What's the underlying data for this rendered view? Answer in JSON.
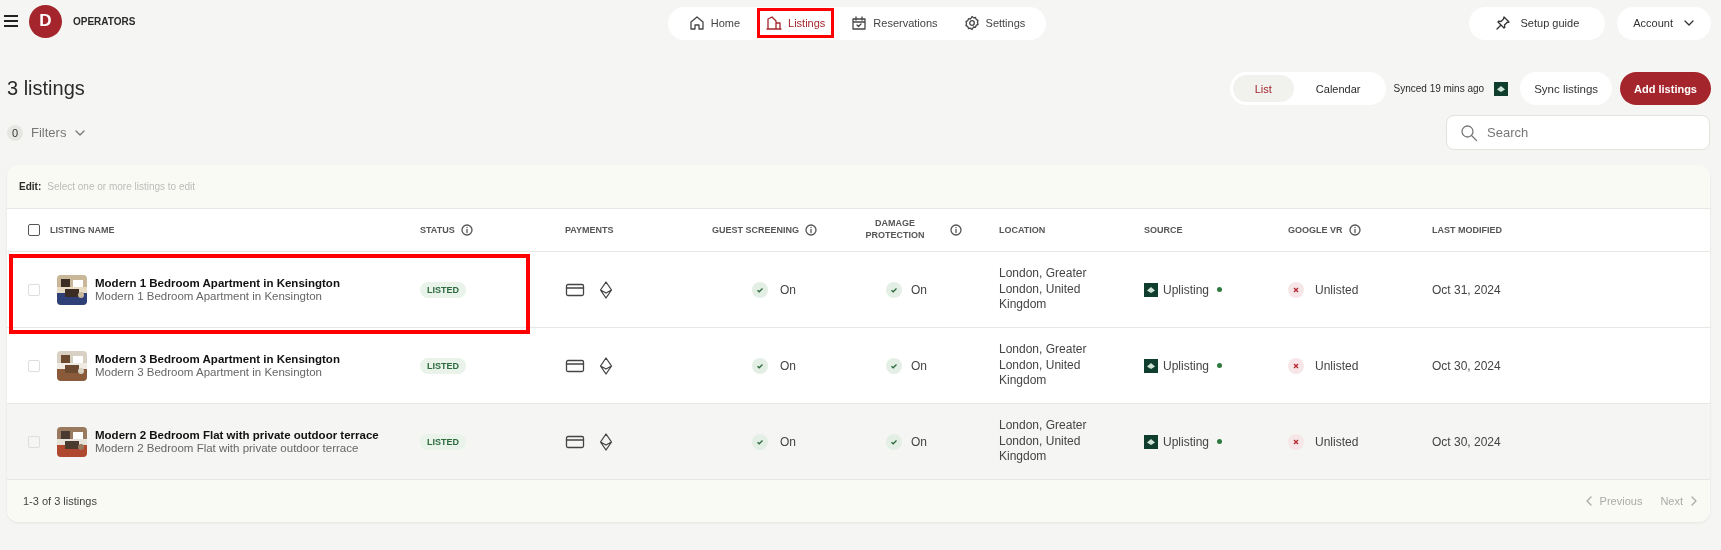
{
  "topbar": {
    "logo_letter": "D",
    "brand": "OPERATORS",
    "nav_items": [
      {
        "kind": "home",
        "label": "Home",
        "selected": false,
        "highlighted": false
      },
      {
        "kind": "listings",
        "label": "Listings",
        "selected": true,
        "highlighted": true
      },
      {
        "kind": "reservations",
        "label": "Reservations",
        "selected": false,
        "highlighted": false
      },
      {
        "kind": "settings",
        "label": "Settings",
        "selected": false,
        "highlighted": false
      }
    ],
    "setup_guide": "Setup guide",
    "account": "Account"
  },
  "header": {
    "title": "3 listings",
    "view_toggle": [
      {
        "label": "List",
        "selected": true
      },
      {
        "label": "Calendar",
        "selected": false
      }
    ],
    "sync_status": "Synced 19 mins ago",
    "sync_button": "Sync listings",
    "add_button": "Add listings"
  },
  "filters": {
    "count": "0",
    "label": "Filters"
  },
  "search": {
    "placeholder": "Search"
  },
  "table": {
    "select_all_checked": false,
    "edit_label": "Edit:",
    "edit_hint": "Select one or more listings to edit",
    "columns": [
      {
        "label": "LISTING NAME",
        "info": false
      },
      {
        "label": "STATUS",
        "info": true
      },
      {
        "label": "PAYMENTS",
        "info": false
      },
      {
        "label": "GUEST SCREENING",
        "info": true
      },
      {
        "label": "DAMAGE PROTECTION",
        "info": true
      },
      {
        "label": "LOCATION",
        "info": false
      },
      {
        "label": "SOURCE",
        "info": false
      },
      {
        "label": "GOOGLE VR",
        "info": true
      },
      {
        "label": "LAST MODIFIED",
        "info": false
      }
    ],
    "rows": [
      {
        "checked": false,
        "highlighted": true,
        "hovered": false,
        "name": "Modern 1 Bedroom Apartment in Kensington",
        "subtitle": "Modern 1 Bedroom Apartment in Kensington",
        "status": "LISTED",
        "guest_screening": {
          "label": "On",
          "on": true
        },
        "damage_protection": {
          "label": "On",
          "on": true
        },
        "location": "London, Greater London, United Kingdom",
        "source": "Uplisting",
        "google_vr": {
          "label": "Unlisted",
          "listed": false
        },
        "last_modified": "Oct 31, 2024"
      },
      {
        "checked": false,
        "highlighted": false,
        "hovered": false,
        "name": "Modern 3 Bedroom Apartment in Kensington",
        "subtitle": "Modern 3 Bedroom Apartment in Kensington",
        "status": "LISTED",
        "guest_screening": {
          "label": "On",
          "on": true
        },
        "damage_protection": {
          "label": "On",
          "on": true
        },
        "location": "London, Greater London, United Kingdom",
        "source": "Uplisting",
        "google_vr": {
          "label": "Unlisted",
          "listed": false
        },
        "last_modified": "Oct 30, 2024"
      },
      {
        "checked": false,
        "highlighted": false,
        "hovered": true,
        "name": "Modern 2 Bedroom Flat with private outdoor terrace",
        "subtitle": "Modern 2 Bedroom Flat with private outdoor terrace",
        "status": "LISTED",
        "guest_screening": {
          "label": "On",
          "on": true
        },
        "damage_protection": {
          "label": "On",
          "on": true
        },
        "location": "London, Greater London, United Kingdom",
        "source": "Uplisting",
        "google_vr": {
          "label": "Unlisted",
          "listed": false
        },
        "last_modified": "Oct 30, 2024"
      }
    ],
    "footer_count": "1-3 of 3 listings",
    "previous": "Previous",
    "next": "Next"
  }
}
